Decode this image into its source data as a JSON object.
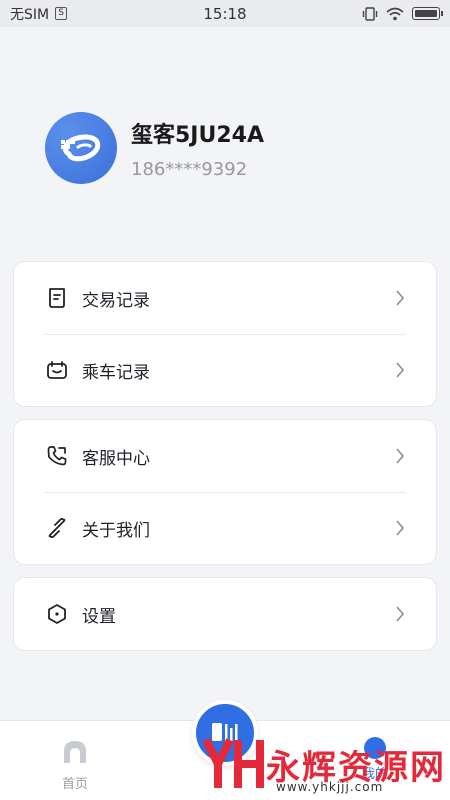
{
  "status_bar": {
    "carrier": "无SIM",
    "sim_badge": "S",
    "time": "15:18"
  },
  "profile": {
    "username": "玺客5JU24A",
    "phone": "186****9392"
  },
  "menu_groups": [
    {
      "items": [
        {
          "label": "交易记录",
          "icon": "receipt-icon"
        },
        {
          "label": "乘车记录",
          "icon": "ticket-icon"
        }
      ]
    },
    {
      "items": [
        {
          "label": "客服中心",
          "icon": "phone-icon"
        },
        {
          "label": "关于我们",
          "icon": "link-icon"
        }
      ]
    },
    {
      "items": [
        {
          "label": "设置",
          "icon": "hexagon-settings-icon"
        }
      ]
    }
  ],
  "bottom_nav": {
    "home_label": "首页",
    "mine_label": "我的"
  },
  "watermark": {
    "text": "永辉资源网",
    "url": "www.yhkjjj.com"
  },
  "colors": {
    "accent": "#2f6fe3",
    "background": "#f2f4f7",
    "watermark": "#e42a3a"
  }
}
